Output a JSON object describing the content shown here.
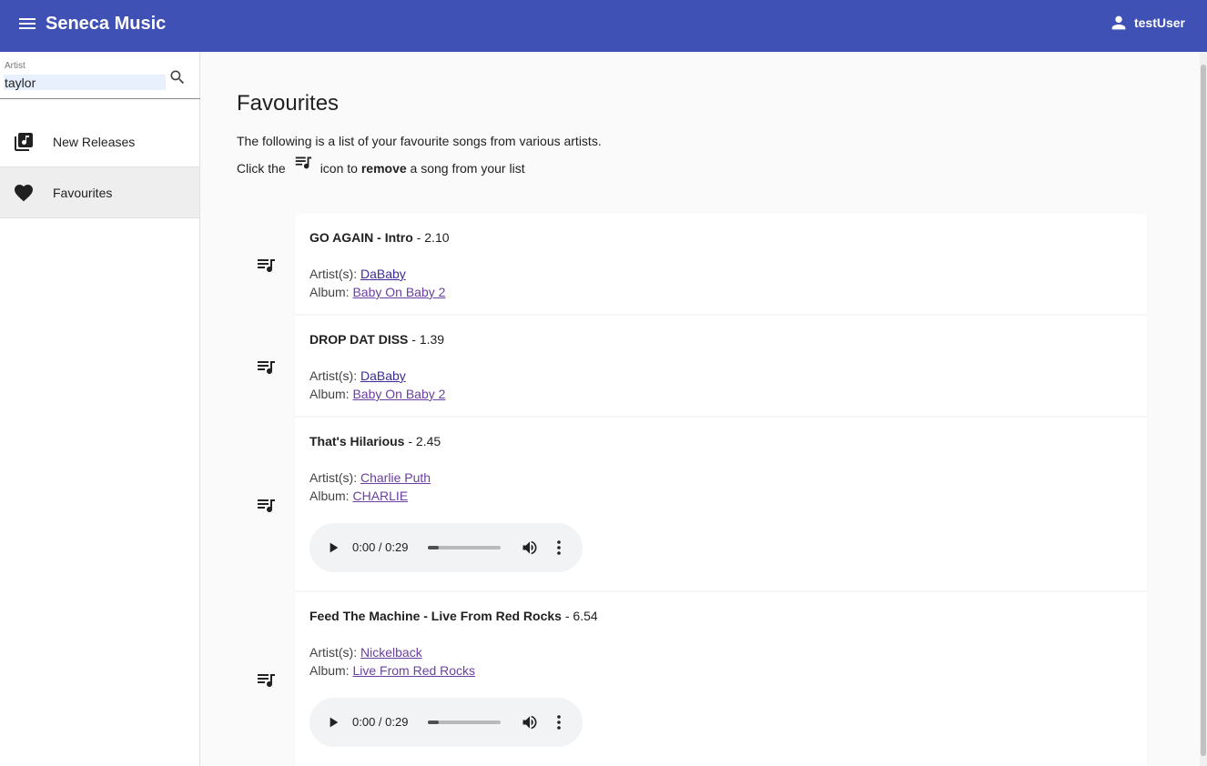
{
  "header": {
    "title": "Seneca Music",
    "user": "testUser",
    "bg_color": "#3f51b5"
  },
  "search": {
    "label": "Artist",
    "value": "taylor"
  },
  "sidebar": {
    "items": [
      {
        "label": "New Releases",
        "icon": "library-music-icon",
        "active": false
      },
      {
        "label": "Favourites",
        "icon": "heart-icon",
        "active": true
      }
    ]
  },
  "main": {
    "title": "Favourites",
    "intro_line1": "The following is a list of your favourite songs from various artists.",
    "intro_click": "Click the",
    "intro_icon_to": "icon to",
    "intro_remove": "remove",
    "intro_rest": "a song from your list",
    "songs": [
      {
        "name": "GO AGAIN - Intro",
        "duration": "2.10",
        "artist_label": "Artist(s):",
        "artist": "DaBaby",
        "album_label": "Album:",
        "album": "Baby On Baby 2",
        "has_preview": false
      },
      {
        "name": "DROP DAT DISS",
        "duration": "1.39",
        "artist_label": "Artist(s):",
        "artist": "DaBaby",
        "album_label": "Album:",
        "album": "Baby On Baby 2",
        "has_preview": false
      },
      {
        "name": "That's Hilarious",
        "duration": "2.45",
        "artist_label": "Artist(s):",
        "artist": "Charlie Puth",
        "album_label": "Album:",
        "album": "CHARLIE",
        "has_preview": true,
        "player_time": "0:00 / 0:29",
        "progress": 0.15
      },
      {
        "name": "Feed The Machine - Live From Red Rocks",
        "duration": "6.54",
        "artist_label": "Artist(s):",
        "artist": "Nickelback",
        "album_label": "Album:",
        "album": "Live From Red Rocks",
        "has_preview": true,
        "player_time": "0:00 / 0:29",
        "progress": 0.15
      }
    ],
    "duration_separator": " - "
  }
}
